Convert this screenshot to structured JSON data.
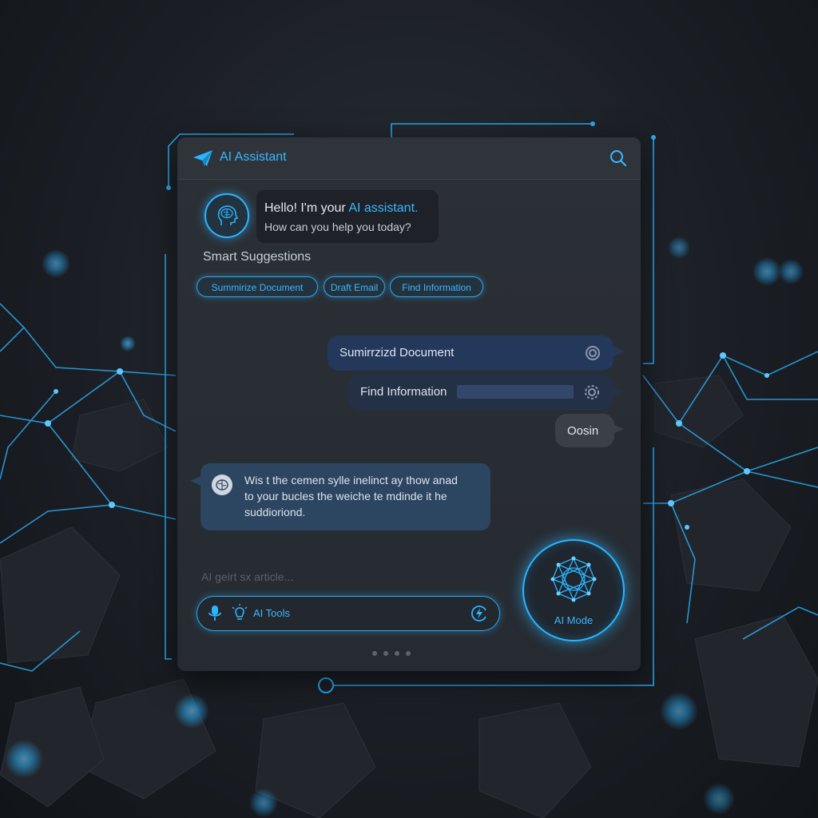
{
  "header": {
    "title": "AI Assistant",
    "logo_icon": "paper-plane-icon",
    "search_icon": "search-icon"
  },
  "greeting": {
    "prefix": "Hello! I'm your ",
    "highlight": "AI assistant.",
    "line2": "How can you help you today?"
  },
  "suggestions": {
    "label": "Smart Suggestions",
    "chips": [
      "Summirize Document",
      "Draft Email",
      "Find Information"
    ]
  },
  "messages": [
    {
      "text": "Sumirrzizd Document",
      "icon": "status-ring-icon"
    },
    {
      "text": "Find Information",
      "icon": "settings-icon"
    },
    {
      "text": "Oosin"
    }
  ],
  "ai_reply": {
    "lines": [
      "Wis t the cemen sylle inelinct ay thow anad",
      "to your bucles the weiche te mdinde it he",
      "suddioriond."
    ]
  },
  "composer": {
    "hint": "AI geirt sx article...",
    "tools_label": "AI Tools",
    "icons": [
      "mic-icon",
      "lightbulb-icon",
      "send-icon"
    ]
  },
  "ai_mode": {
    "label": "AI Mode"
  },
  "pagination": {
    "count": 4
  },
  "colors": {
    "accent": "#3ab6ff",
    "panel": "#2b3036",
    "background": "#1b1f25"
  }
}
